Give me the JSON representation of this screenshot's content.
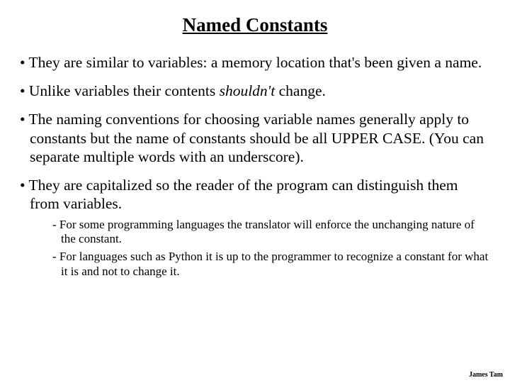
{
  "title": "Named Constants",
  "bullets": {
    "b0": "They are similar to variables: a memory location that's been given a name.",
    "b1_pre": "Unlike variables their contents ",
    "b1_em": "shouldn't",
    "b1_post": " change.",
    "b2": "The naming conventions for choosing variable names generally apply to constants but the name of constants should be all UPPER CASE.  (You can separate multiple words with an underscore).",
    "b3": "They are capitalized so the reader of the program can distinguish them from variables."
  },
  "sub": {
    "s0": "For some programming languages the translator will enforce the unchanging nature of the constant.",
    "s1": "For languages such as Python it is up to the programmer to recognize a constant for what it is and not to change it."
  },
  "footer": "James Tam"
}
